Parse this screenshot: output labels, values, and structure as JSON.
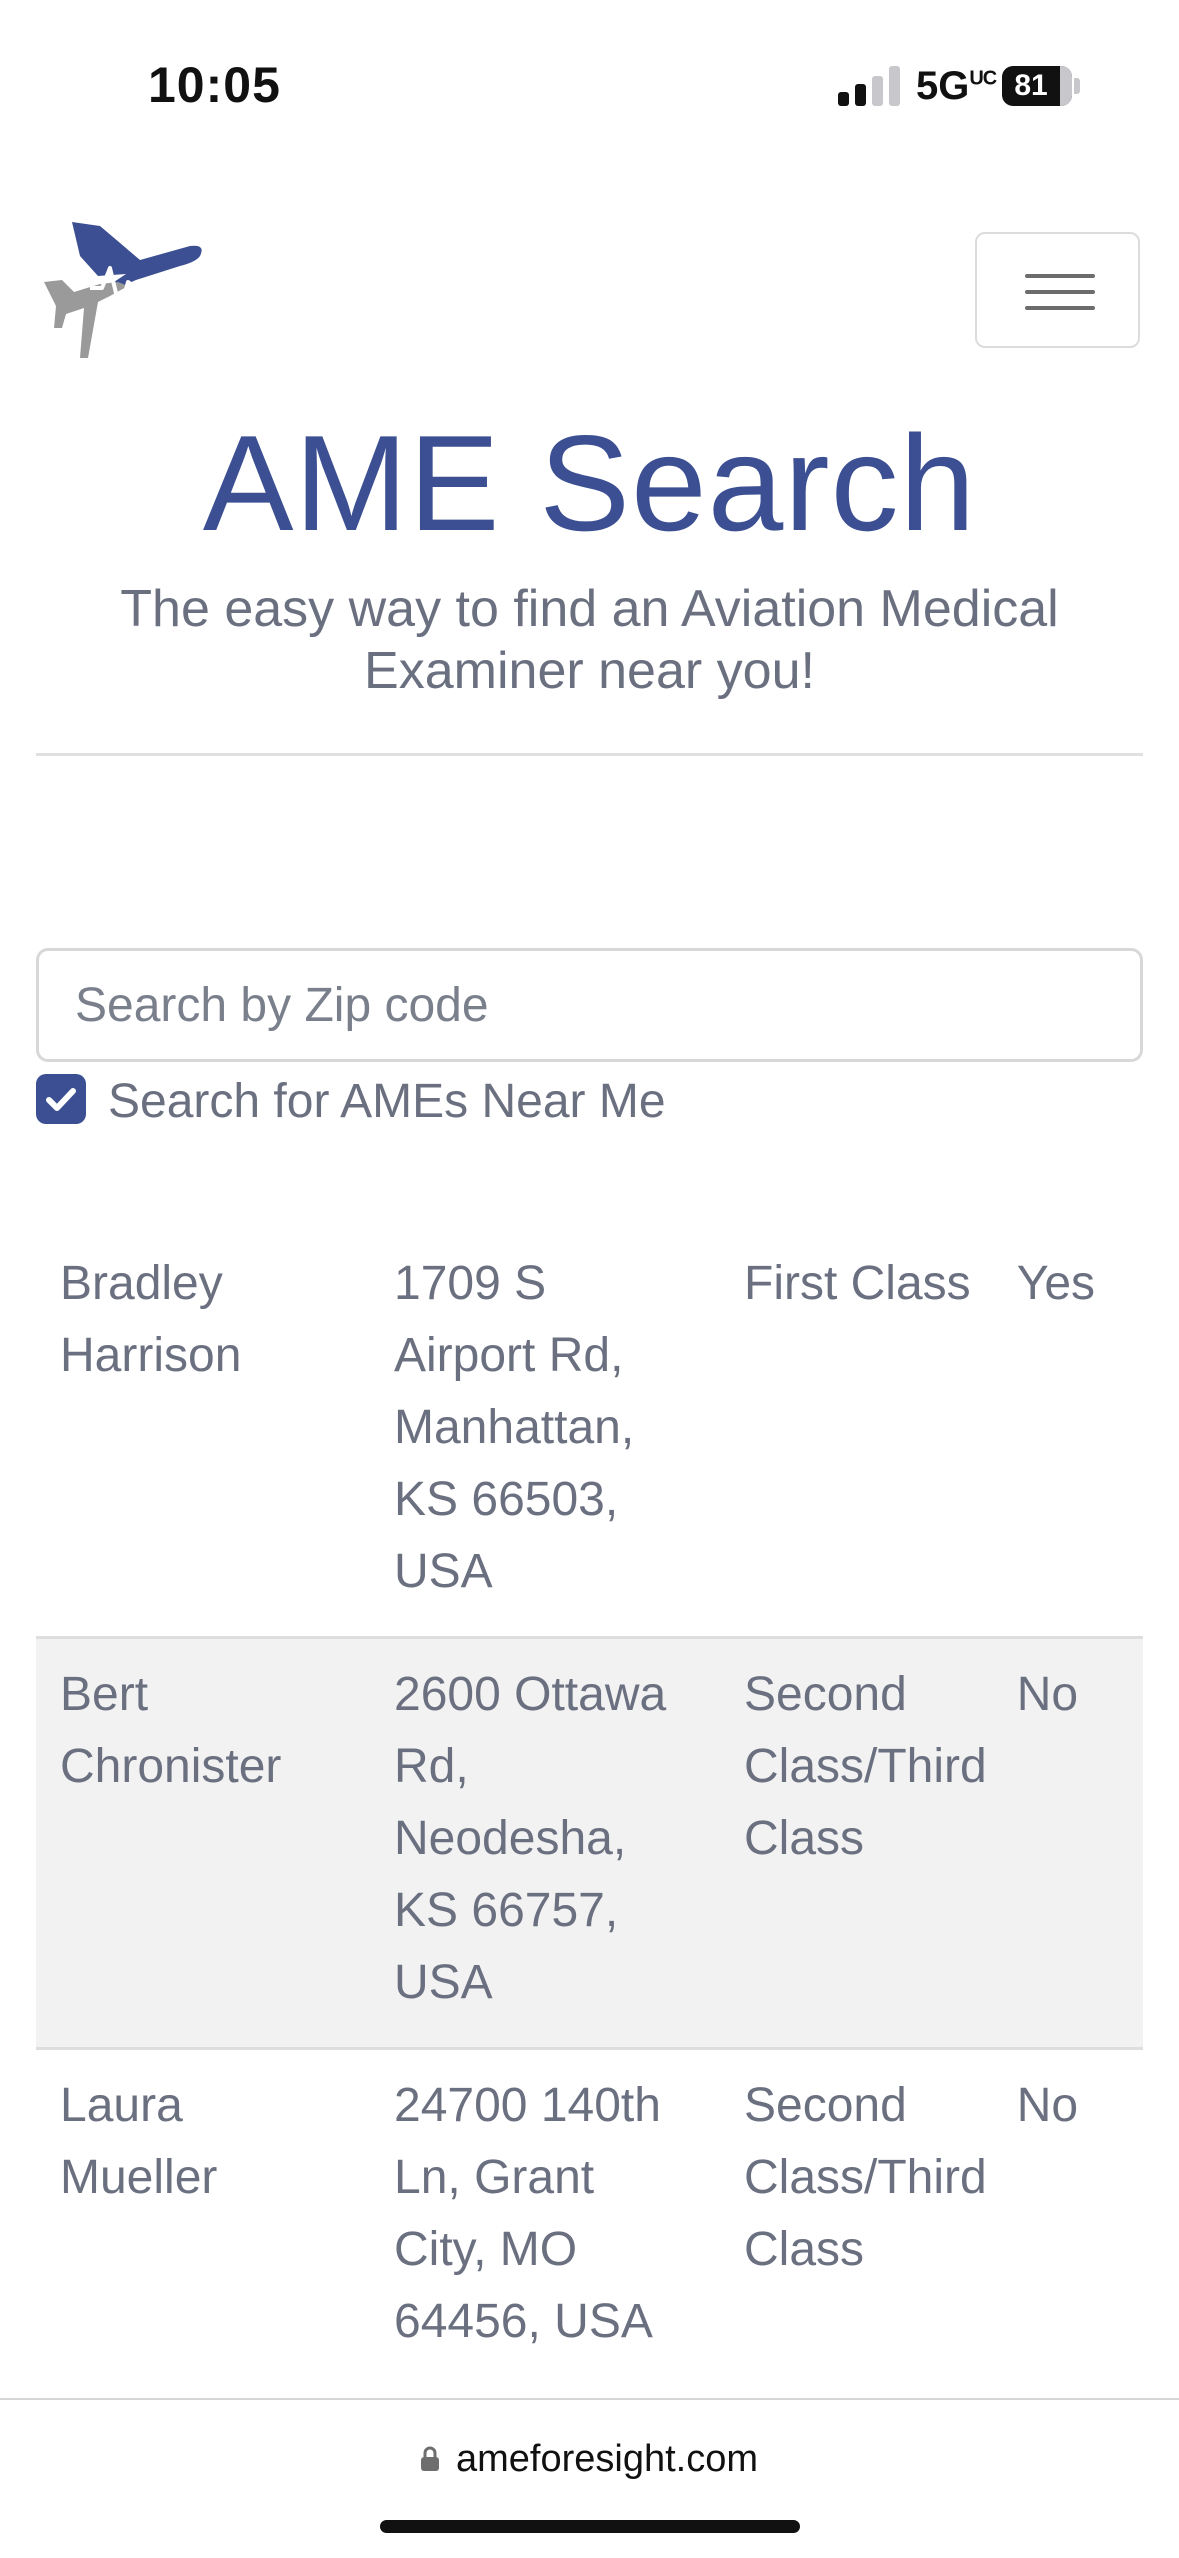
{
  "status_bar": {
    "time": "10:05",
    "network": "5G",
    "network_sub": "UC",
    "battery": "81",
    "icons": [
      "signal-icon",
      "battery-icon"
    ]
  },
  "nav": {
    "logo_icon": "airplane-heartbeat-logo",
    "menu_icon": "hamburger-menu-icon"
  },
  "hero": {
    "title": "AME Search",
    "subtitle": "The easy way to find an Aviation Medical Examiner near you!"
  },
  "search": {
    "placeholder": "Search by Zip code",
    "value": "",
    "near_me_label": "Search for AMEs Near Me",
    "near_me_checked": true
  },
  "results": [
    {
      "name": "Bradley Harrison",
      "address": "1709 S Airport Rd, Manhattan, KS 66503, USA",
      "class": "First Class",
      "flag": "Yes"
    },
    {
      "name": "Bert Chronister",
      "address": "2600 Ottawa Rd, Neodesha, KS 66757, USA",
      "class": "Second Class/Third Class",
      "flag": "No"
    },
    {
      "name": "Laura Mueller",
      "address": "24700 140th Ln, Grant City, MO 64456, USA",
      "class": "Second Class/Third Class",
      "flag": "No"
    }
  ],
  "browser": {
    "url": "ameforesight.com",
    "lock_icon": "lock-icon"
  },
  "colors": {
    "brand": "#3b4f92",
    "text_muted": "#6b7080",
    "stripe": "#f2f2f2",
    "logo_gray": "#9a9a9a"
  }
}
